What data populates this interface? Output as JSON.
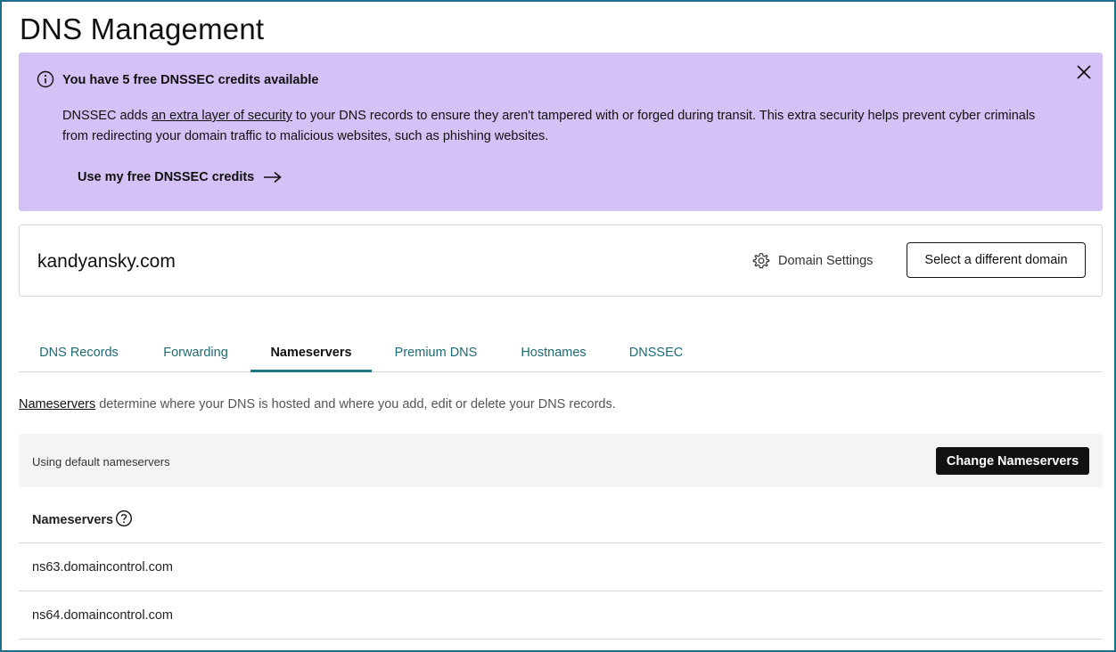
{
  "page": {
    "title": "DNS Management"
  },
  "banner": {
    "title": "You have 5 free DNSSEC credits available",
    "text_before_link": "DNSSEC adds ",
    "link_text": "an extra layer of security",
    "text_after_link": " to your DNS records to ensure they aren't tampered with or forged during transit. This extra security helps prevent cyber criminals from redirecting your domain traffic to malicious websites, such as phishing websites.",
    "cta_label": "Use my free DNSSEC credits",
    "background_color": "#d4c1f5"
  },
  "domain": {
    "name": "kandyansky.com",
    "settings_label": "Domain Settings",
    "select_button_label": "Select a different domain"
  },
  "tabs": [
    {
      "label": "DNS Records",
      "active": false
    },
    {
      "label": "Forwarding",
      "active": false
    },
    {
      "label": "Nameservers",
      "active": true
    },
    {
      "label": "Premium DNS",
      "active": false
    },
    {
      "label": "Hostnames",
      "active": false
    },
    {
      "label": "DNSSEC",
      "active": false
    }
  ],
  "nameservers_section": {
    "desc_link": "Nameservers",
    "desc_text": " determine where your DNS is hosted and where you add, edit or delete your DNS records.",
    "default_text": "Using default nameservers",
    "change_button_label": "Change Nameservers",
    "list_title": "Nameservers",
    "items": [
      "ns63.domaincontrol.com",
      "ns64.domaincontrol.com"
    ]
  },
  "colors": {
    "accent": "#1d7b84",
    "tab_text": "#1d6b73",
    "frame_border": "#1f6f8b"
  },
  "icons": {
    "info": "info-icon",
    "close": "close-icon",
    "arrow": "arrow-right-icon",
    "gear": "gear-icon",
    "help": "help-circle-icon"
  }
}
